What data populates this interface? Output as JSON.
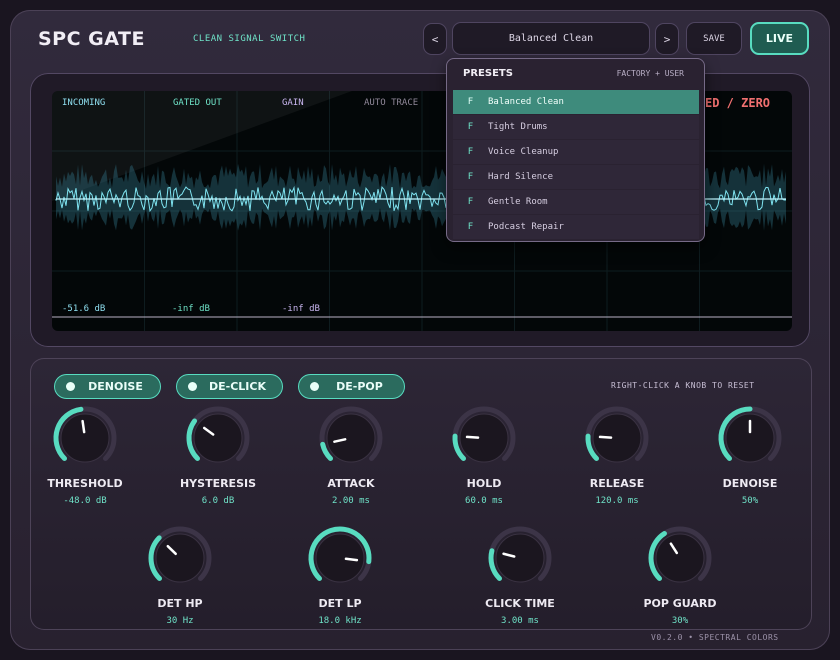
{
  "header": {
    "title": "SPC GATE",
    "subtitle": "CLEAN SIGNAL SWITCH",
    "prev_label": "<",
    "preset_name": "Balanced Clean",
    "next_label": ">",
    "save_label": "SAVE",
    "live_label": "LIVE"
  },
  "scope": {
    "labels": [
      {
        "text": "INCOMING",
        "color": "#8fdff0"
      },
      {
        "text": "GATED OUT",
        "color": "#6fe3c8"
      },
      {
        "text": "GAIN",
        "color": "#c9b6f0"
      },
      {
        "text": "AUTO TRACE",
        "color": "#8f8798"
      }
    ],
    "status_partial": "ED / ZERO",
    "status_color": "#f07070",
    "readouts": [
      {
        "text": "-51.6 dB",
        "color": "#8fdff0"
      },
      {
        "text": "-inf dB",
        "color": "#6fe3c8"
      },
      {
        "text": "-inf dB",
        "color": "#c9b6f0"
      }
    ]
  },
  "presets": {
    "heading": "PRESETS",
    "scope_label": "FACTORY + USER",
    "selected_index": 0,
    "items": [
      {
        "badge": "F",
        "name": "Balanced Clean"
      },
      {
        "badge": "F",
        "name": "Tight Drums"
      },
      {
        "badge": "F",
        "name": "Voice Cleanup"
      },
      {
        "badge": "F",
        "name": "Hard Silence"
      },
      {
        "badge": "F",
        "name": "Gentle Room"
      },
      {
        "badge": "F",
        "name": "Podcast Repair"
      }
    ]
  },
  "toggles": [
    {
      "label": "DENOISE",
      "on": true
    },
    {
      "label": "DE-CLICK",
      "on": true
    },
    {
      "label": "DE-POP",
      "on": true
    }
  ],
  "hint": "RIGHT-CLICK A KNOB TO RESET",
  "knobs": [
    {
      "label": "THRESHOLD",
      "value": "-48.0 dB",
      "level": 0.47
    },
    {
      "label": "HYSTERESIS",
      "value": "6.0 dB",
      "level": 0.3
    },
    {
      "label": "ATTACK",
      "value": "2.00 ms",
      "level": 0.12
    },
    {
      "label": "HOLD",
      "value": "60.0 ms",
      "level": 0.18
    },
    {
      "label": "RELEASE",
      "value": "120.0 ms",
      "level": 0.18
    },
    {
      "label": "DENOISE",
      "value": "50%",
      "level": 0.5
    },
    {
      "label": "DET HP",
      "value": "30 Hz",
      "level": 0.33
    },
    {
      "label": "DET LP",
      "value": "18.0 kHz",
      "level": 0.86
    },
    {
      "label": "CLICK TIME",
      "value": "3.00 ms",
      "level": 0.22
    },
    {
      "label": "POP GUARD",
      "value": "30%",
      "level": 0.38
    }
  ],
  "footer": "V0.2.0  •  SPECTRAL COLORS",
  "colors": {
    "accent": "#58dcc0",
    "knob_track": "#3c3447",
    "wave_incoming": "#7fe3f0"
  }
}
